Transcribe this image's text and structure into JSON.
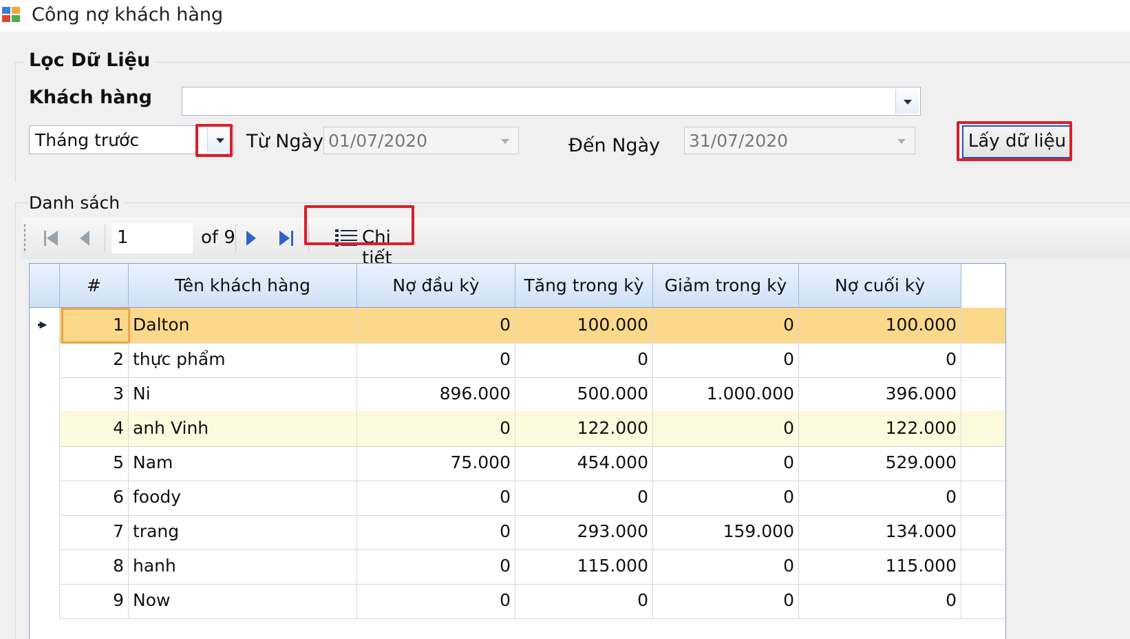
{
  "window": {
    "title": "Công nợ khách hàng",
    "icon": "app-window-icon"
  },
  "filter": {
    "group_title": "Lọc Dữ Liệu",
    "customer_label": "Khách hàng",
    "customer_value": "",
    "period_value": "Tháng trước",
    "from_label": "Từ Ngày",
    "from_date": "01/07/2020",
    "to_label": "Đến Ngày",
    "to_date": "31/07/2020",
    "get_button": "Lấy dữ liệu"
  },
  "list": {
    "title": "Danh sách",
    "navigator": {
      "position": "1",
      "of_label": "of 9",
      "detail_button": "Chi tiết"
    },
    "columns": [
      "#",
      "Tên khách hàng",
      "Nợ đầu kỳ",
      "Tăng trong kỳ",
      "Giảm trong kỳ",
      "Nợ cuối kỳ"
    ],
    "rows": [
      [
        "1",
        "Dalton",
        "0",
        "100.000",
        "0",
        "100.000"
      ],
      [
        "2",
        "thực phẩm",
        "0",
        "0",
        "0",
        "0"
      ],
      [
        "3",
        "Ni",
        "896.000",
        "500.000",
        "1.000.000",
        "396.000"
      ],
      [
        "4",
        "anh Vinh",
        "0",
        "122.000",
        "0",
        "122.000"
      ],
      [
        "5",
        "Nam",
        "75.000",
        "454.000",
        "0",
        "529.000"
      ],
      [
        "6",
        "foody",
        "0",
        "0",
        "0",
        "0"
      ],
      [
        "7",
        "trang",
        "0",
        "293.000",
        "159.000",
        "134.000"
      ],
      [
        "8",
        "hanh",
        "0",
        "115.000",
        "0",
        "115.000"
      ],
      [
        "9",
        "Now",
        "0",
        "0",
        "0",
        "0"
      ]
    ],
    "selected_row": 0,
    "hover_row": 3
  },
  "colors": {
    "highlight": "#d8202a",
    "selected_row": "#fbd88a",
    "hover_row": "#fdf9dd",
    "header": "#cfe0f6"
  }
}
